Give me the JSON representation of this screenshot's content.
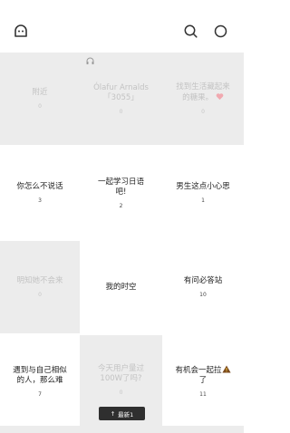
{
  "toast": {
    "arrow": "↑",
    "label": "最新1"
  },
  "cells": [
    {
      "title": "附近",
      "count": "0"
    },
    {
      "title": "Ólafur Arnalds\n「3055」",
      "count": "0"
    },
    {
      "title": "找到生活藏起来\n的糖果。",
      "count": "0"
    },
    {
      "title": "你怎么不说话",
      "count": "3"
    },
    {
      "title": "一起学习日语\n吧!",
      "count": "2"
    },
    {
      "title": "男生这点小心思",
      "count": "1"
    },
    {
      "title": "明知她不会来",
      "count": "0"
    },
    {
      "title": "我的时空",
      "count": ""
    },
    {
      "title": "有问必答站",
      "count": "10"
    },
    {
      "title": "遇到与自己相似\n的人，那么难",
      "count": "7"
    },
    {
      "title": "今天用户量过\n100W了吗?",
      "count": "0"
    },
    {
      "title": "有机会一起拉",
      "title2": "了",
      "count": "11"
    }
  ]
}
